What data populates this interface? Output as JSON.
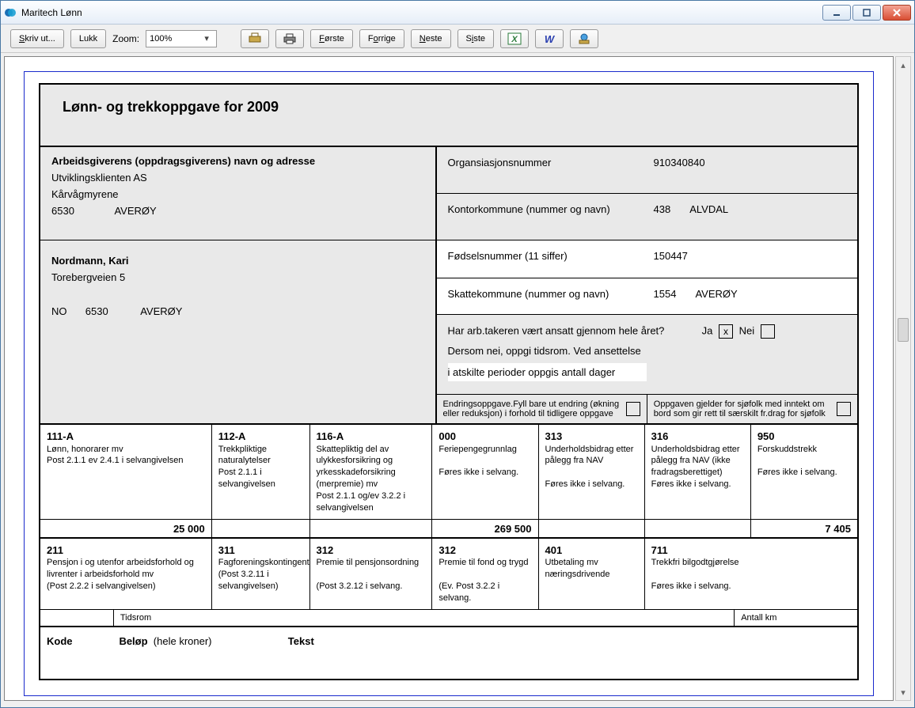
{
  "window": {
    "title": "Maritech Lønn"
  },
  "toolbar": {
    "print": "Skriv ut...",
    "close": "Lukk",
    "zoom_label": "Zoom:",
    "zoom_value": "100%",
    "first": "Første",
    "prev": "Forrige",
    "next": "Neste",
    "last": "Siste"
  },
  "report": {
    "title": "Lønn- og trekkoppgave for  2009",
    "employer_heading": "Arbeidsgiverens (oppdragsgiverens) navn og adresse",
    "employer_name": "Utviklingsklienten AS",
    "employer_addr1": "Kårvågmyrene",
    "employer_zip": "6530",
    "employer_city": "AVERØY",
    "employee_name": "Nordmann, Kari",
    "employee_addr": "Torebergveien 5",
    "employee_country": "NO",
    "employee_zip": "6530",
    "employee_city": "AVERØY",
    "org_label": "Organsiasjonsnummer",
    "org_value": "910340840",
    "office_label": "Kontorkommune (nummer og navn)",
    "office_num": "438",
    "office_name": "ALVDAL",
    "fnr_label": "Fødselsnummer (11 siffer)",
    "fnr_value": "150447",
    "tax_label": "Skattekommune (nummer og navn)",
    "tax_num": "1554",
    "tax_name": "AVERØY",
    "emp_q1": "Har arb.takeren vært ansatt gjennom hele året?",
    "emp_q1_yes": "Ja",
    "emp_q1_no": "Nei",
    "emp_q2": "Dersom nei, oppgi tidsrom. Ved ansettelse",
    "emp_q3": "i atskilte perioder oppgis antall dager",
    "chg_text": "Endringsoppgave.Fyll bare ut endring (økning eller reduksjon) i forhold til tidligere oppgave",
    "sea_text": "Oppgaven gjelder for sjøfolk med inntekt om bord som gir rett til særskilt fr.drag for sjøfolk",
    "codes1": [
      {
        "code": "111-A",
        "desc": "Lønn, honorarer mv\nPost 2.1.1 ev 2.4.1 i selvangivelsen",
        "val": "25 000"
      },
      {
        "code": "112-A",
        "desc": "Trekkpliktige naturalytelser\nPost 2.1.1 i selvangivelsen",
        "val": ""
      },
      {
        "code": "116-A",
        "desc": "Skattepliktig del av ulykkesforsikring og yrkesskadeforsikring (merpremie) mv\nPost 2.1.1 og/ev 3.2.2 i selvangivelsen",
        "val": ""
      },
      {
        "code": "000",
        "desc": "Feriepengegrunnlag\n\nFøres ikke i selvang.",
        "val": "269 500"
      },
      {
        "code": "313",
        "desc": "Underholdsbidrag etter pålegg fra NAV\n\nFøres ikke i selvang.",
        "val": ""
      },
      {
        "code": "316",
        "desc": "Underholdsbidrag etter pålegg fra NAV (ikke fradragsberettiget)\nFøres ikke i selvang.",
        "val": ""
      },
      {
        "code": "950",
        "desc": "Forskuddstrekk\n\nFøres ikke i selvang.",
        "val": "7 405"
      }
    ],
    "codes2": [
      {
        "code": "211",
        "desc": "Pensjon i og utenfor arbeidsforhold og livrenter i arbeidsforhold mv\n(Post 2.2.2 i selvangivelsen)"
      },
      {
        "code": "311",
        "desc": "Fagforeningskontingent\n(Post 3.2.11 i selvangivelsen)"
      },
      {
        "code": "312",
        "desc": "Premie til pensjonsordning\n\n(Post 3.2.12 i selvang."
      },
      {
        "code": "312",
        "desc": "Premie til fond og trygd\n\n(Ev. Post 3.2.2 i selvang."
      },
      {
        "code": "401",
        "desc": "Utbetaling mv næringsdrivende"
      },
      {
        "code": "711",
        "desc": "Trekkfri bilgodtgjørelse\n\nFøres ikke i selvang."
      }
    ],
    "tidsrom": "Tidsrom",
    "antallkm": "Antall km",
    "foot_kode": "Kode",
    "foot_belop": "Beløp",
    "foot_hele": "(hele kroner)",
    "foot_tekst": "Tekst"
  }
}
